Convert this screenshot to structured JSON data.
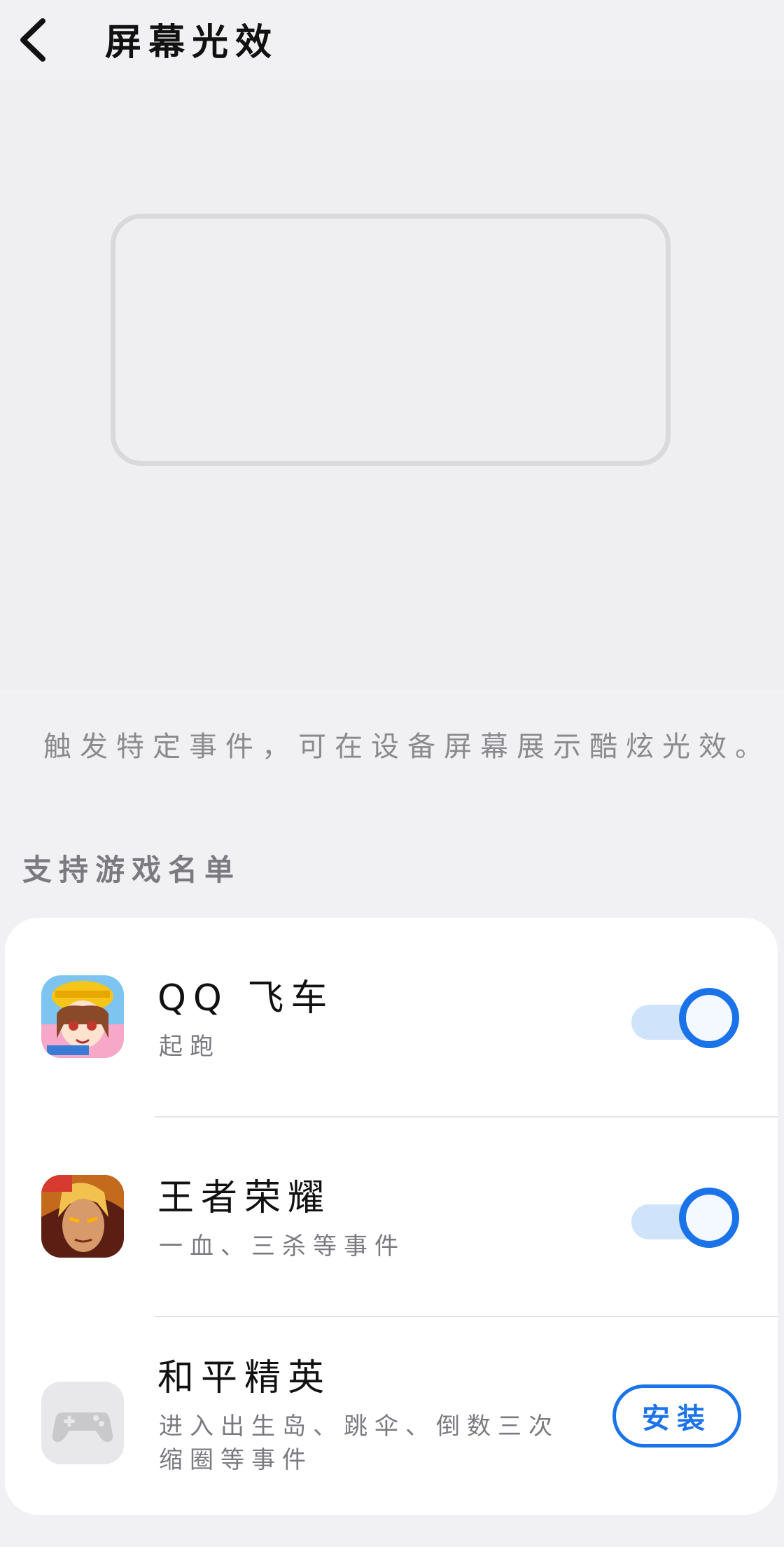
{
  "header": {
    "title": "屏幕光效"
  },
  "description": "触发特定事件，可在设备屏幕展示酷炫光效。",
  "section_title": "支持游戏名单",
  "games": [
    {
      "name": "QQ 飞车",
      "detail": "起跑",
      "action": "toggle",
      "enabled": true,
      "icon": "qq-speed-game-icon"
    },
    {
      "name": "王者荣耀",
      "detail": "一血、三杀等事件",
      "action": "toggle",
      "enabled": true,
      "icon": "honor-of-kings-icon"
    },
    {
      "name": "和平精英",
      "detail_line1": "进入出生岛、跳伞、倒数三次",
      "detail_line2": "缩圈等事件",
      "action": "install",
      "install_label": "安装",
      "icon": "gamepad-icon"
    }
  ],
  "colors": {
    "accent": "#1a73e8",
    "background": "#f1f1f3",
    "card": "#ffffff"
  }
}
